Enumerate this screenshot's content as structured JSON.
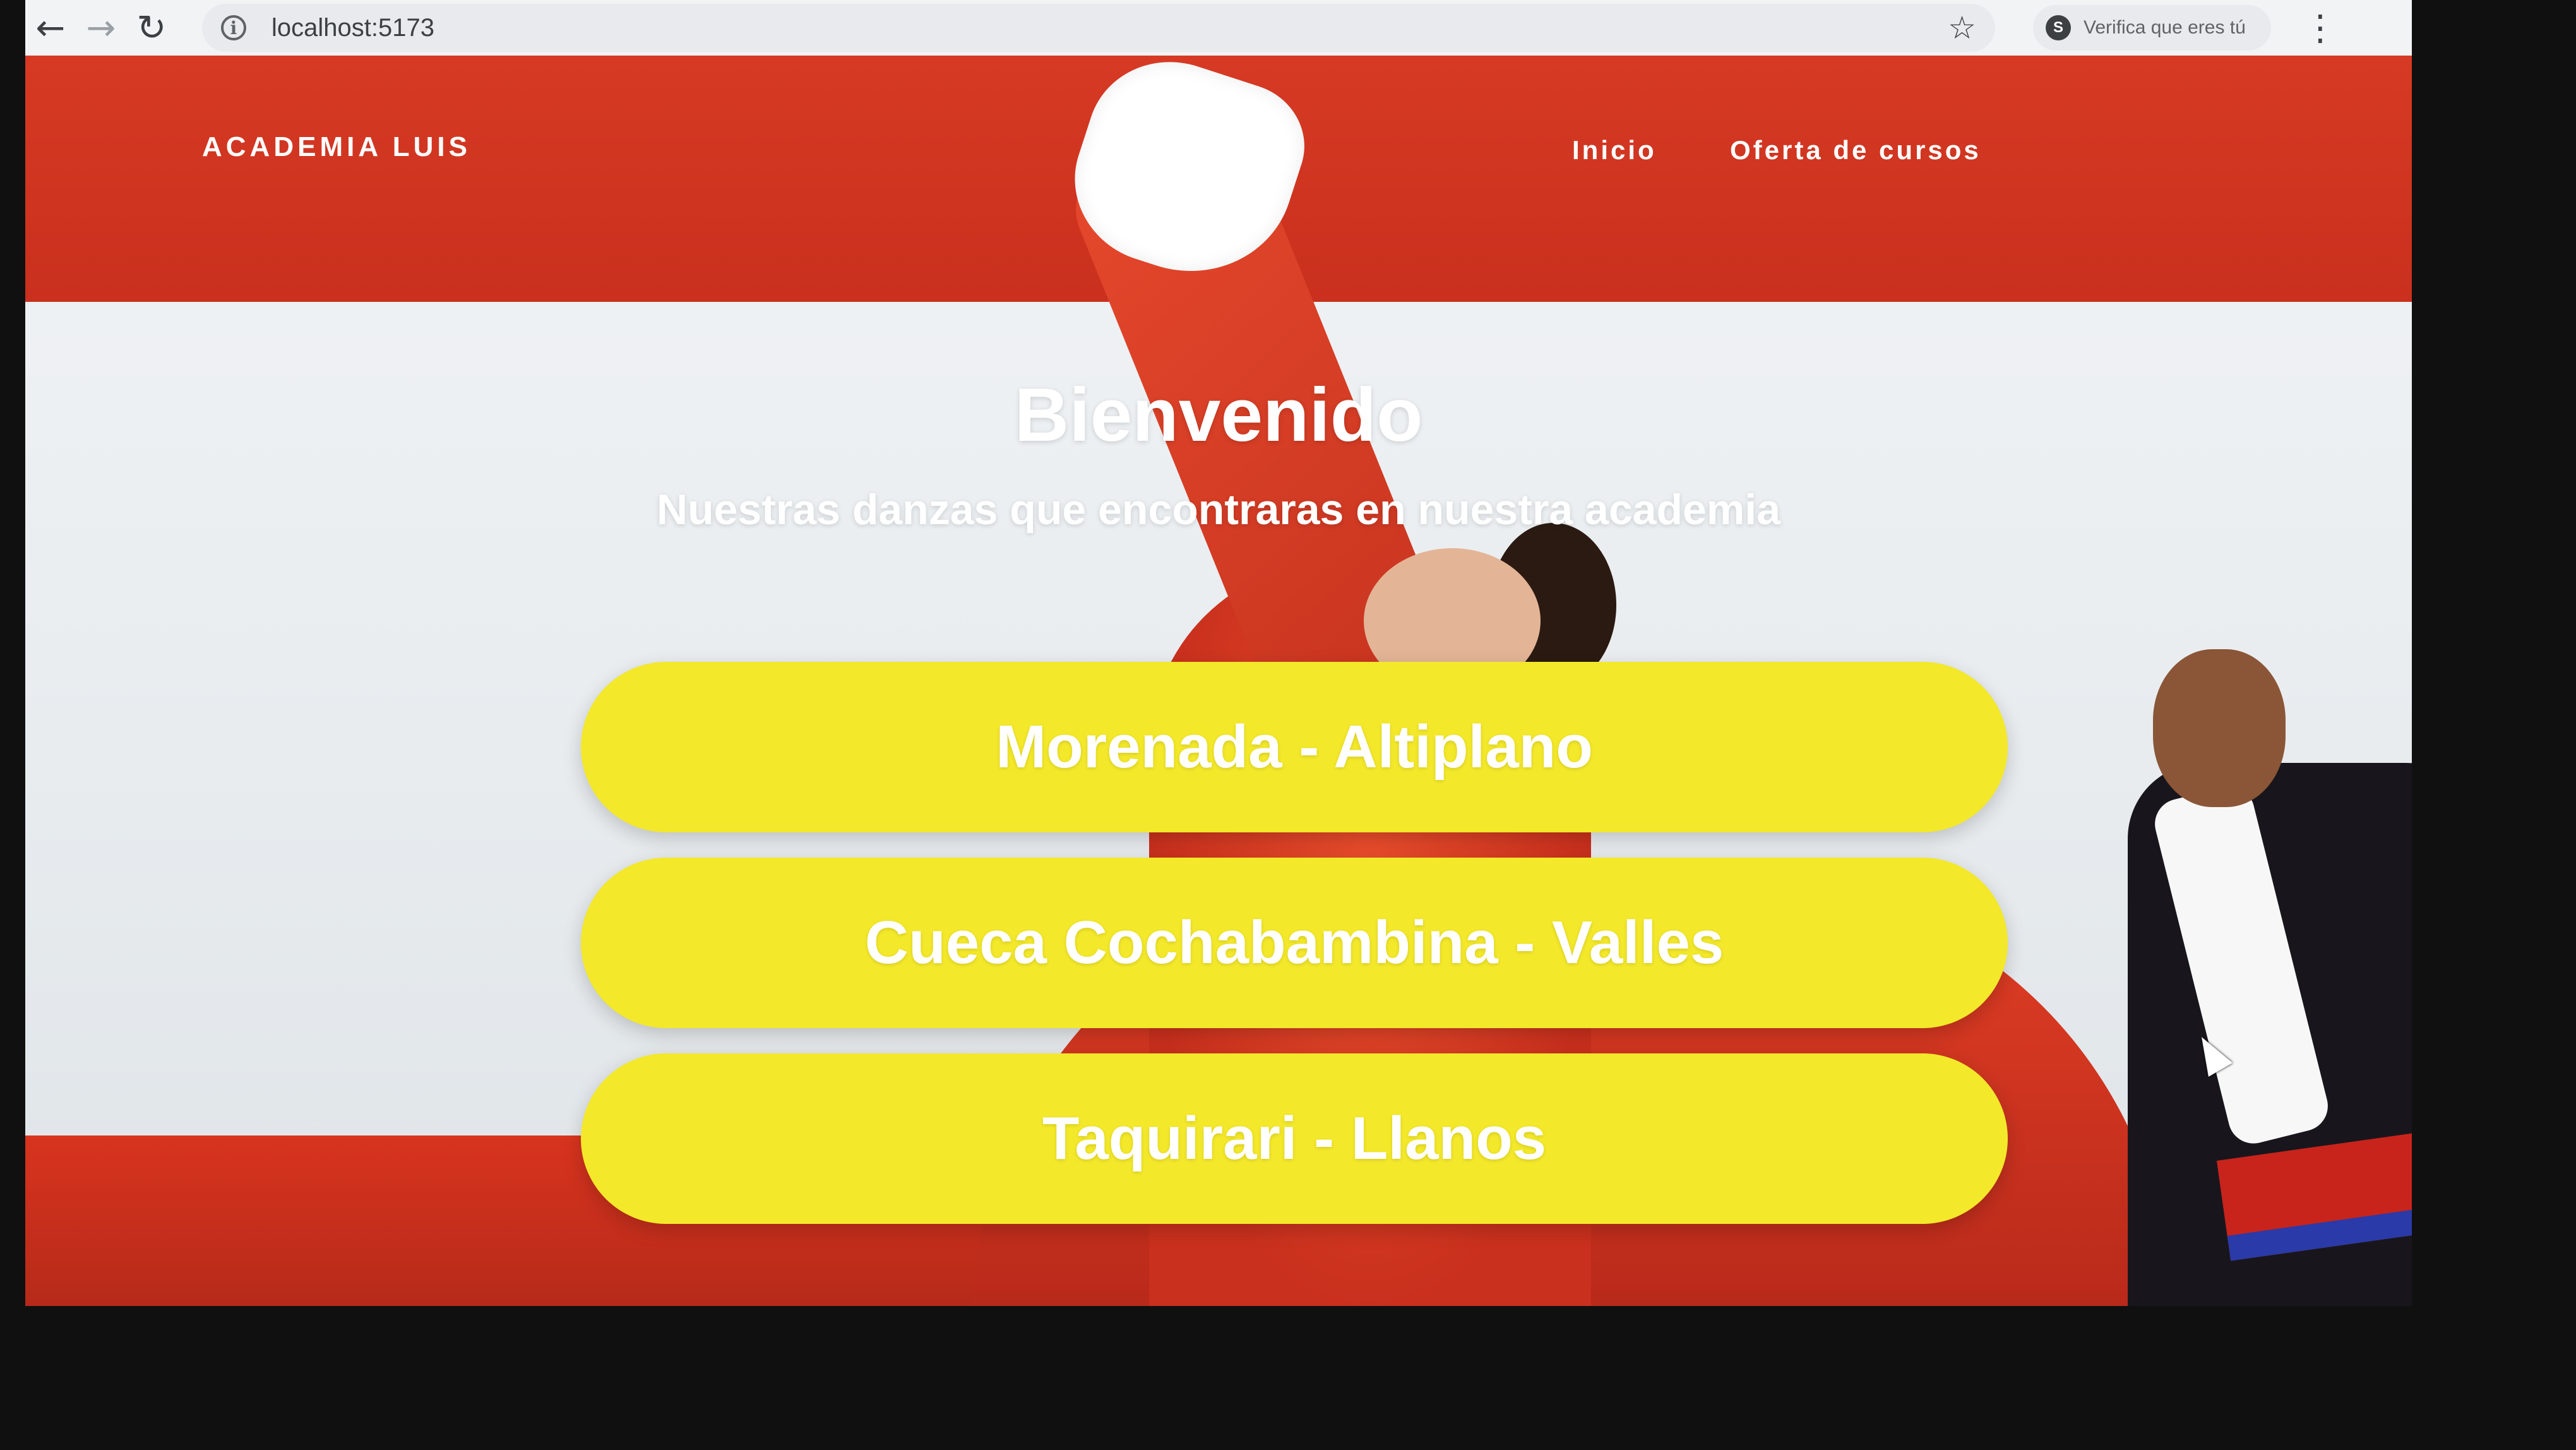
{
  "browser": {
    "back_icon": "←",
    "forward_icon": "→",
    "reload_icon": "↻",
    "info_icon": "i",
    "url": "localhost:5173",
    "star_icon": "☆",
    "profile_initial": "S",
    "profile_text": "Verifica que eres tú",
    "menu_icon": "⋮"
  },
  "header": {
    "brand": "ACADEMIA LUIS",
    "nav": [
      {
        "label": "Inicio"
      },
      {
        "label": "Oferta de cursos"
      }
    ]
  },
  "hero": {
    "title": "Bienvenido",
    "subtitle": "Nuestras danzas que encontraras en nuestra academia"
  },
  "courses": [
    {
      "label": "Morenada - Altiplano"
    },
    {
      "label": "Cueca Cochabambina - Valles"
    },
    {
      "label": "Taquirari - Llanos"
    }
  ],
  "colors": {
    "band_red": "#d63a24",
    "button_yellow": "#f3e82a",
    "text_white": "#ffffff"
  }
}
